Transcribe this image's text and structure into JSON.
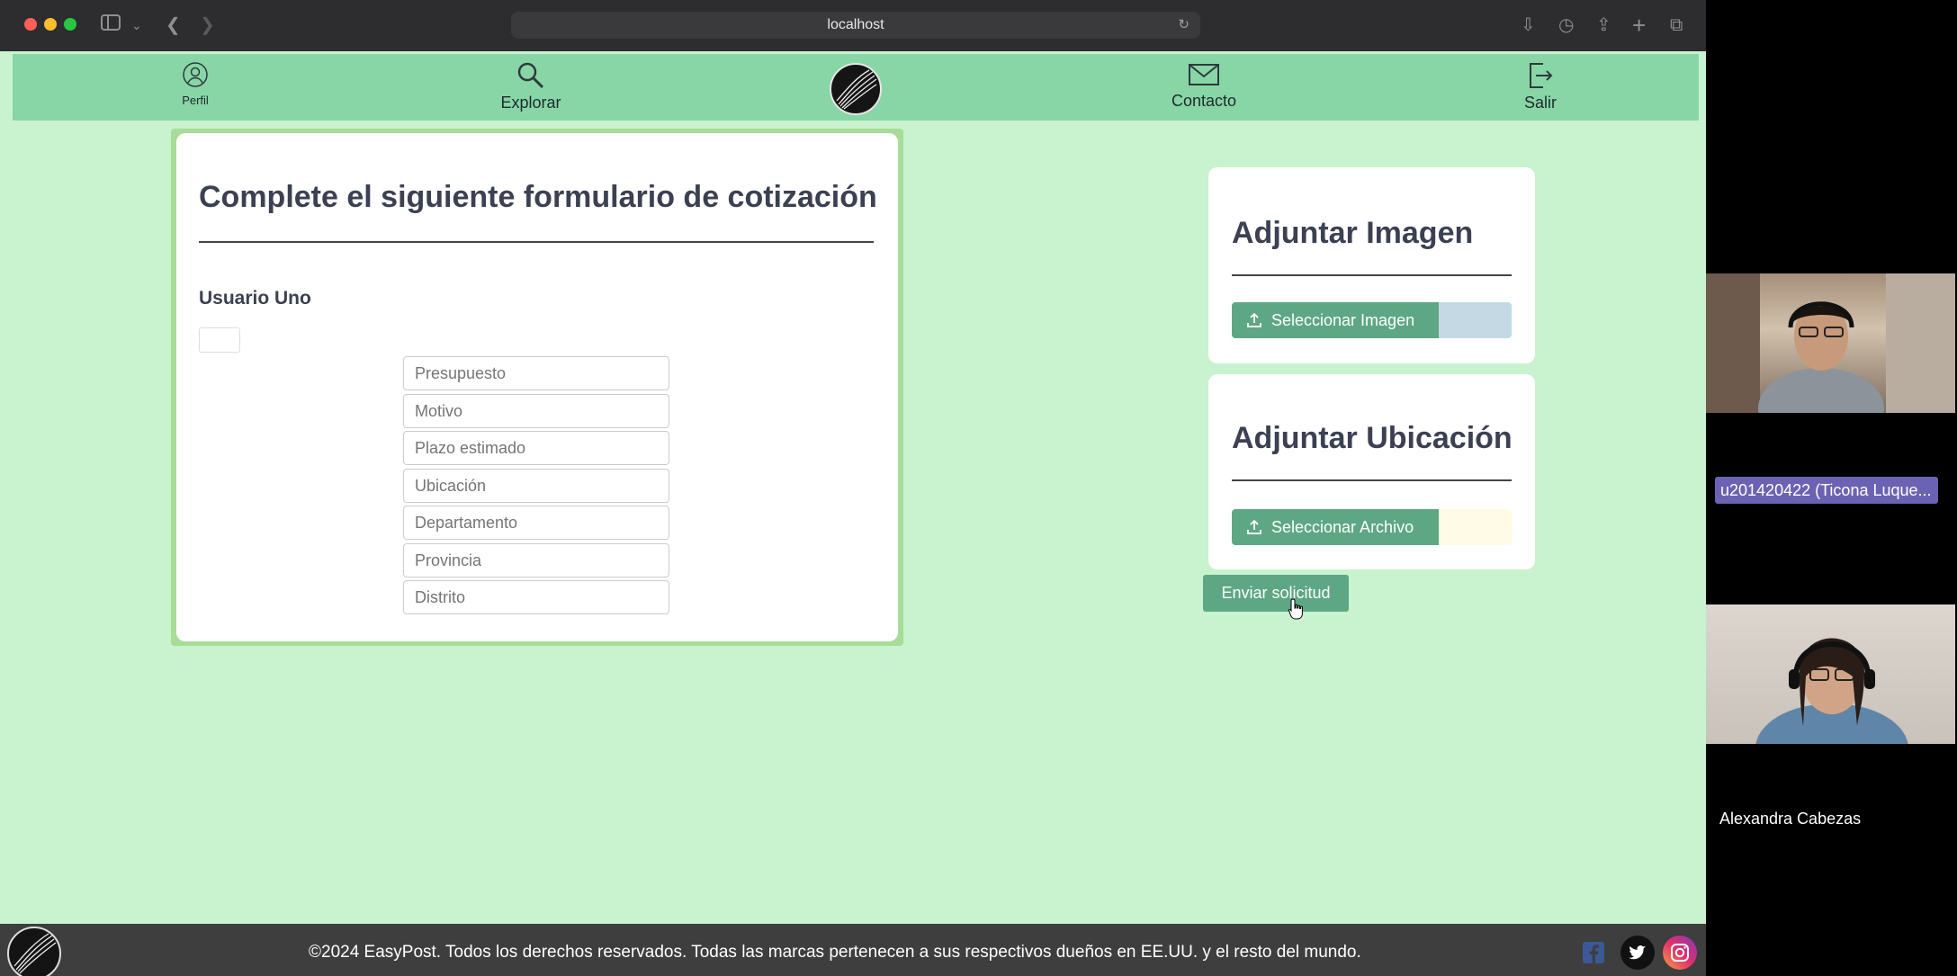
{
  "browser": {
    "url": "localhost"
  },
  "nav": {
    "perfil": "Perfil",
    "explorar": "Explorar",
    "contacto": "Contacto",
    "salir": "Salir"
  },
  "form": {
    "title": "Complete el siguiente formulario de cotización",
    "user": "Usuario Uno",
    "placeholders": {
      "presupuesto": "Presupuesto",
      "motivo": "Motivo",
      "plazo": "Plazo estimado",
      "ubicacion": "Ubicación",
      "departamento": "Departamento",
      "provincia": "Provincia",
      "distrito": "Distrito"
    }
  },
  "imagen": {
    "title": "Adjuntar Imagen",
    "button": "Seleccionar Imagen"
  },
  "ubicacion": {
    "title": "Adjuntar Ubicación",
    "button": "Seleccionar Archivo"
  },
  "send_button": "Enviar solicitud",
  "footer": {
    "text": "©2024 EasyPost. Todos los derechos reservados. Todas las marcas pertenecen a sus respectivos dueños en EE.UU. y el resto del mundo."
  },
  "call": {
    "participant1": "u201420422 (Ticona Luque...",
    "participant2": "Alexandra Cabezas"
  },
  "colors": {
    "page_bg": "#c9f2cf",
    "navbar": "#88d6a6",
    "accent_button": "#5ea784",
    "footer": "#3e3e3e"
  }
}
